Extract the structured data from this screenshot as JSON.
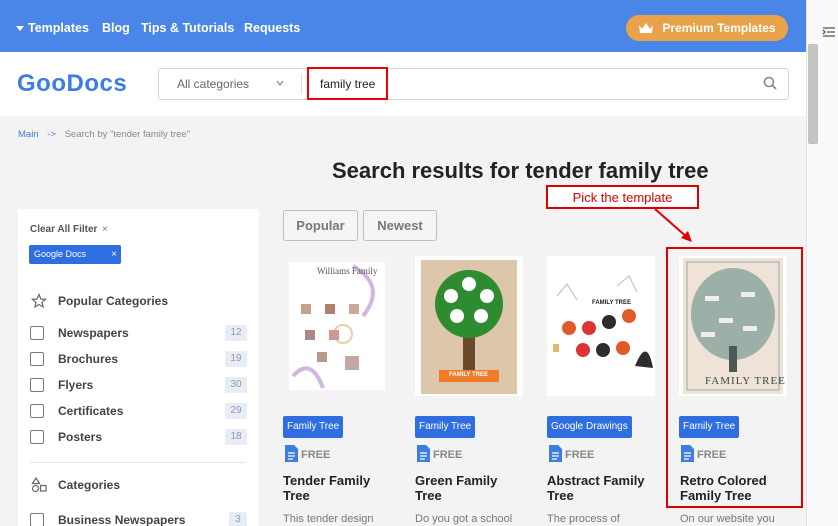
{
  "nav": {
    "items": [
      "Templates",
      "Blog",
      "Tips & Tutorials",
      "Requests"
    ],
    "premium_label": "Premium Templates"
  },
  "header": {
    "logo": "GooDocs",
    "category_select": "All categories",
    "search_value": "family tree"
  },
  "breadcrumb": {
    "home": "Main",
    "separator": "->",
    "current": "Search by \"tender family tree\""
  },
  "page_title": "Search results for tender family tree",
  "annotation": "Pick the template",
  "sidebar": {
    "clear_filter": "Clear All Filter",
    "clear_icon": "×",
    "active_chip": "Google Docs",
    "chip_close": "×",
    "popular_heading": "Popular Categories",
    "popular": [
      {
        "label": "Newspapers",
        "count": "12"
      },
      {
        "label": "Brochures",
        "count": "19"
      },
      {
        "label": "Flyers",
        "count": "30"
      },
      {
        "label": "Certificates",
        "count": "29"
      },
      {
        "label": "Posters",
        "count": "18"
      }
    ],
    "categories_heading": "Categories",
    "categories": [
      {
        "label": "Business Newspapers",
        "count": "3"
      }
    ]
  },
  "sort": {
    "popular": "Popular",
    "newest": "Newest"
  },
  "cards": [
    {
      "tag": "Family Tree",
      "free": "FREE",
      "title_1": "Tender Family",
      "title_2": "Tree",
      "desc": "This tender design",
      "thumb_title": "Williams Family"
    },
    {
      "tag": "Family Tree",
      "free": "FREE",
      "title_1": "Green Family",
      "title_2": "Tree",
      "desc": "Do you got a school",
      "thumb_title": "FAMILY TREE"
    },
    {
      "tag": "Google Drawings",
      "free": "FREE",
      "title_1": "Abstract Family",
      "title_2": "Tree",
      "desc": "The process of",
      "thumb_title": "FAMILY TREE"
    },
    {
      "tag": "Family Tree",
      "free": "FREE",
      "title_1": "Retro Colored",
      "title_2": "Family Tree",
      "desc": "On our website you",
      "thumb_title": "FAMILY TREE"
    }
  ],
  "colors": {
    "nav_blue": "#4a86e8",
    "premium_orange": "#e8a24a",
    "tag_blue": "#2f6ee0",
    "highlight_red": "#e00000"
  }
}
